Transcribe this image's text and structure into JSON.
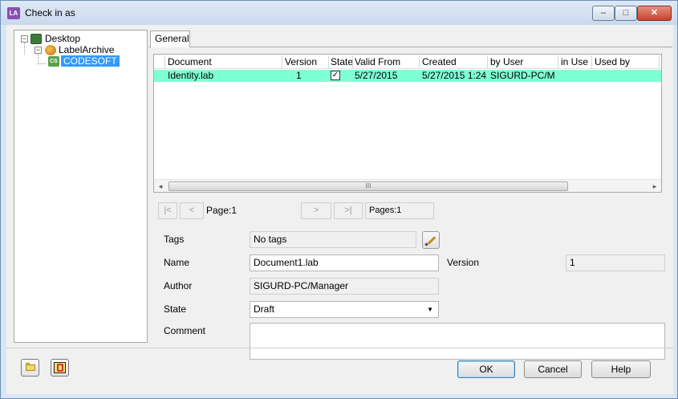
{
  "window": {
    "title": "Check in as",
    "app_icon": "LA"
  },
  "tree": {
    "items": [
      {
        "label": "Desktop",
        "icon": "desktop-icon"
      },
      {
        "label": "LabelArchive",
        "icon": "archive-icon"
      },
      {
        "label": "CODESOFT",
        "icon": "codesoft-icon",
        "icon_text": "CS",
        "selected": true
      }
    ]
  },
  "tab": {
    "label": "General"
  },
  "grid": {
    "columns": [
      "Document",
      "Version",
      "State",
      "Valid From",
      "Created",
      "by User",
      "in Use",
      "Used by"
    ],
    "rows": [
      {
        "document": "Identity.lab",
        "version": "1",
        "state_checked": true,
        "valid_from": "5/27/2015",
        "created": "5/27/2015 1:24",
        "by_user": "SIGURD-PC/M",
        "in_use": "",
        "used_by": ""
      }
    ],
    "row_highlight": "#7fffd4",
    "scroll_thumb_glyph": "III"
  },
  "pager": {
    "first": "|<",
    "prev": "<",
    "page_label": "Page:1",
    "next": ">",
    "last": ">|",
    "pages_label": "Pages:1"
  },
  "form": {
    "tags_label": "Tags",
    "tags_value": "No tags",
    "name_label": "Name",
    "name_value": "Document1.lab",
    "version_label": "Version",
    "version_value": "1",
    "author_label": "Author",
    "author_value": "SIGURD-PC/Manager",
    "state_label": "State",
    "state_value": "Draft",
    "comment_label": "Comment",
    "comment_value": ""
  },
  "buttons": {
    "ok": "OK",
    "cancel": "Cancel",
    "help": "Help"
  },
  "colors": {
    "selection": "#3399ff",
    "row_highlight": "#7fffd4",
    "close_button": "#c5432c"
  }
}
